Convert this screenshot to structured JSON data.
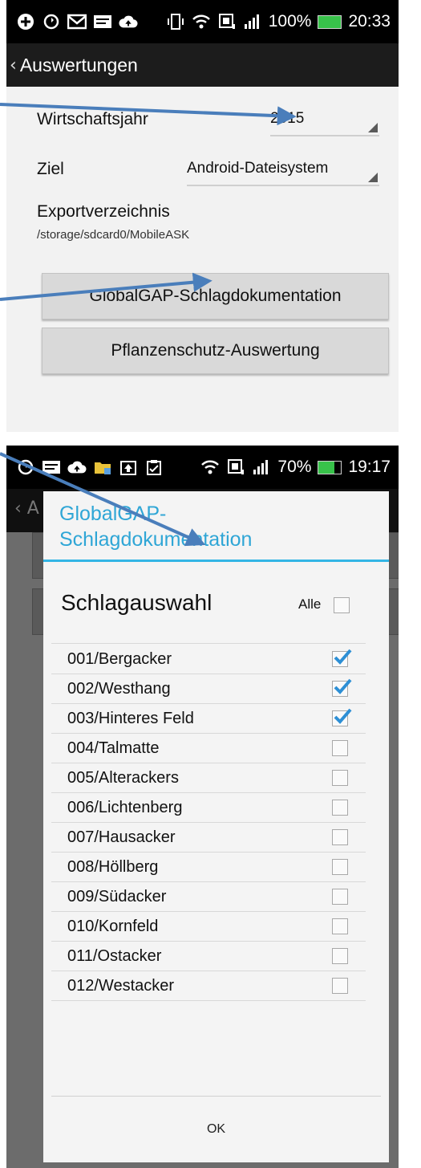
{
  "screen1": {
    "status": {
      "left_icons": [
        "plus-icon",
        "sync-icon",
        "mail-icon",
        "message-icon",
        "cloud-icon"
      ],
      "right_icons": [
        "vibrate-icon",
        "wifi-icon",
        "nfc-icon",
        "signal-icon"
      ],
      "battery_text": "100%",
      "battery_level": 1.0,
      "time": "20:33"
    },
    "header": {
      "back_glyph": "‹",
      "title": "Auswertungen"
    },
    "wirtschaftsjahr": {
      "label": "Wirtschaftsjahr",
      "value": "2015"
    },
    "ziel": {
      "label": "Ziel",
      "value": "Android-Dateisystem"
    },
    "export": {
      "label": "Exportverzeichnis",
      "path": "/storage/sdcard0/MobileASK"
    },
    "buttons": {
      "globalgap": "GlobalGAP-Schlagdokumentation",
      "pflanzenschutz": "Pflanzenschutz-Auswertung"
    }
  },
  "screen2": {
    "status": {
      "left_icons": [
        "sync-icon",
        "message-icon",
        "cloud-icon",
        "folder-icon",
        "upload-icon",
        "clipboard-icon"
      ],
      "right_icons": [
        "wifi-icon",
        "nfc-icon",
        "signal-icon"
      ],
      "battery_text": "70%",
      "battery_level": 0.7,
      "time": "19:17"
    },
    "bg_header_fragment": "‹ A",
    "dialog": {
      "title_line1": "GlobalGAP-",
      "title_line2": "Schlagdokumentation",
      "section_title": "Schlagauswahl",
      "select_all_label": "Alle",
      "select_all_checked": false,
      "ok_label": "OK",
      "items": [
        {
          "name": "001/Bergacker",
          "checked": true
        },
        {
          "name": "002/Westhang",
          "checked": true
        },
        {
          "name": "003/Hinteres Feld",
          "checked": true
        },
        {
          "name": "004/Talmatte",
          "checked": false
        },
        {
          "name": "005/Alterackers",
          "checked": false
        },
        {
          "name": "006/Lichtenberg",
          "checked": false
        },
        {
          "name": "007/Hausacker",
          "checked": false
        },
        {
          "name": "008/Höllberg",
          "checked": false
        },
        {
          "name": "009/Südacker",
          "checked": false
        },
        {
          "name": "010/Kornfeld",
          "checked": false
        },
        {
          "name": "011/Ostacker",
          "checked": false
        },
        {
          "name": "012/Westacker",
          "checked": false
        }
      ]
    }
  },
  "colors": {
    "accent": "#33b5e5",
    "arrow": "#4a7ebb",
    "check": "#2d8fd5"
  }
}
